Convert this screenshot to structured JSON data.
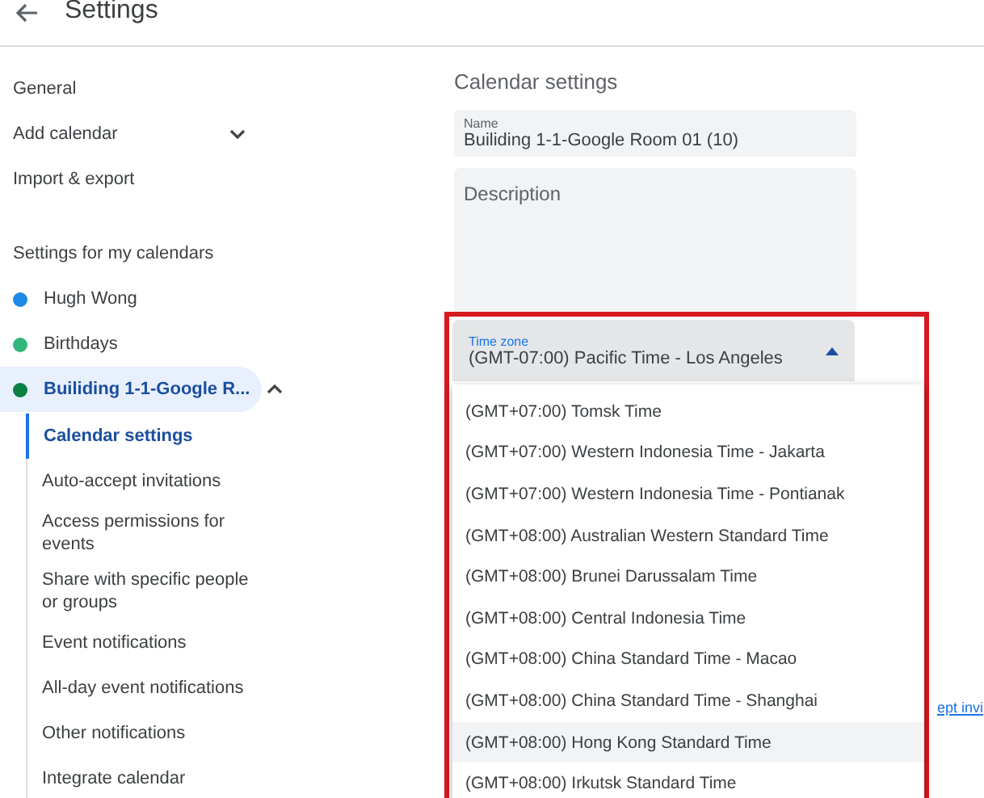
{
  "header": {
    "title": "Settings"
  },
  "sidebar": {
    "items": [
      {
        "kind": "link",
        "label": "General"
      },
      {
        "kind": "link",
        "label": "Add calendar",
        "expanded": false
      },
      {
        "kind": "link",
        "label": "Import & export"
      },
      {
        "kind": "header",
        "label": "Settings for my calendars"
      },
      {
        "kind": "calendar",
        "label": "Hugh Wong",
        "color": "#1e88e5",
        "selected": false
      },
      {
        "kind": "calendar",
        "label": "Birthdays",
        "color": "#33b679",
        "selected": false
      },
      {
        "kind": "calendar",
        "label": "Builiding 1-1-Google R...",
        "color": "#0b8043",
        "selected": true,
        "expanded": true,
        "children": [
          {
            "label": "Calendar settings",
            "selected": true
          },
          {
            "label": "Auto-accept invitations",
            "selected": false
          },
          {
            "label": "Access permissions for events",
            "selected": false
          },
          {
            "label": "Share with specific people or groups",
            "selected": false
          },
          {
            "label": "Event notifications",
            "selected": false
          },
          {
            "label": "All-day event notifications",
            "selected": false
          },
          {
            "label": "Other notifications",
            "selected": false
          },
          {
            "label": "Integrate calendar",
            "selected": false
          }
        ]
      }
    ]
  },
  "main": {
    "title": "Calendar settings",
    "name_field": {
      "label": "Name",
      "value": "Builiding 1-1-Google Room 01 (10)"
    },
    "description_field": {
      "placeholder": "Description"
    },
    "time_zone": {
      "label": "Time zone",
      "value": "(GMT-07:00) Pacific Time - Los Angeles",
      "expanded": true,
      "options": [
        {
          "label": "(GMT+07:00) Tomsk Time",
          "highlighted": false
        },
        {
          "label": "(GMT+07:00) Western Indonesia Time - Jakarta",
          "highlighted": false
        },
        {
          "label": "(GMT+07:00) Western Indonesia Time - Pontianak",
          "highlighted": false
        },
        {
          "label": "(GMT+08:00) Australian Western Standard Time",
          "highlighted": false
        },
        {
          "label": "(GMT+08:00) Brunei Darussalam Time",
          "highlighted": false
        },
        {
          "label": "(GMT+08:00) Central Indonesia Time",
          "highlighted": false
        },
        {
          "label": "(GMT+08:00) China Standard Time - Macao",
          "highlighted": false
        },
        {
          "label": "(GMT+08:00) China Standard Time - Shanghai",
          "highlighted": false
        },
        {
          "label": "(GMT+08:00) Hong Kong Standard Time",
          "highlighted": true
        },
        {
          "label": "(GMT+08:00) Irkutsk Standard Time",
          "highlighted": false
        }
      ]
    },
    "hidden_link": "ept invi"
  }
}
